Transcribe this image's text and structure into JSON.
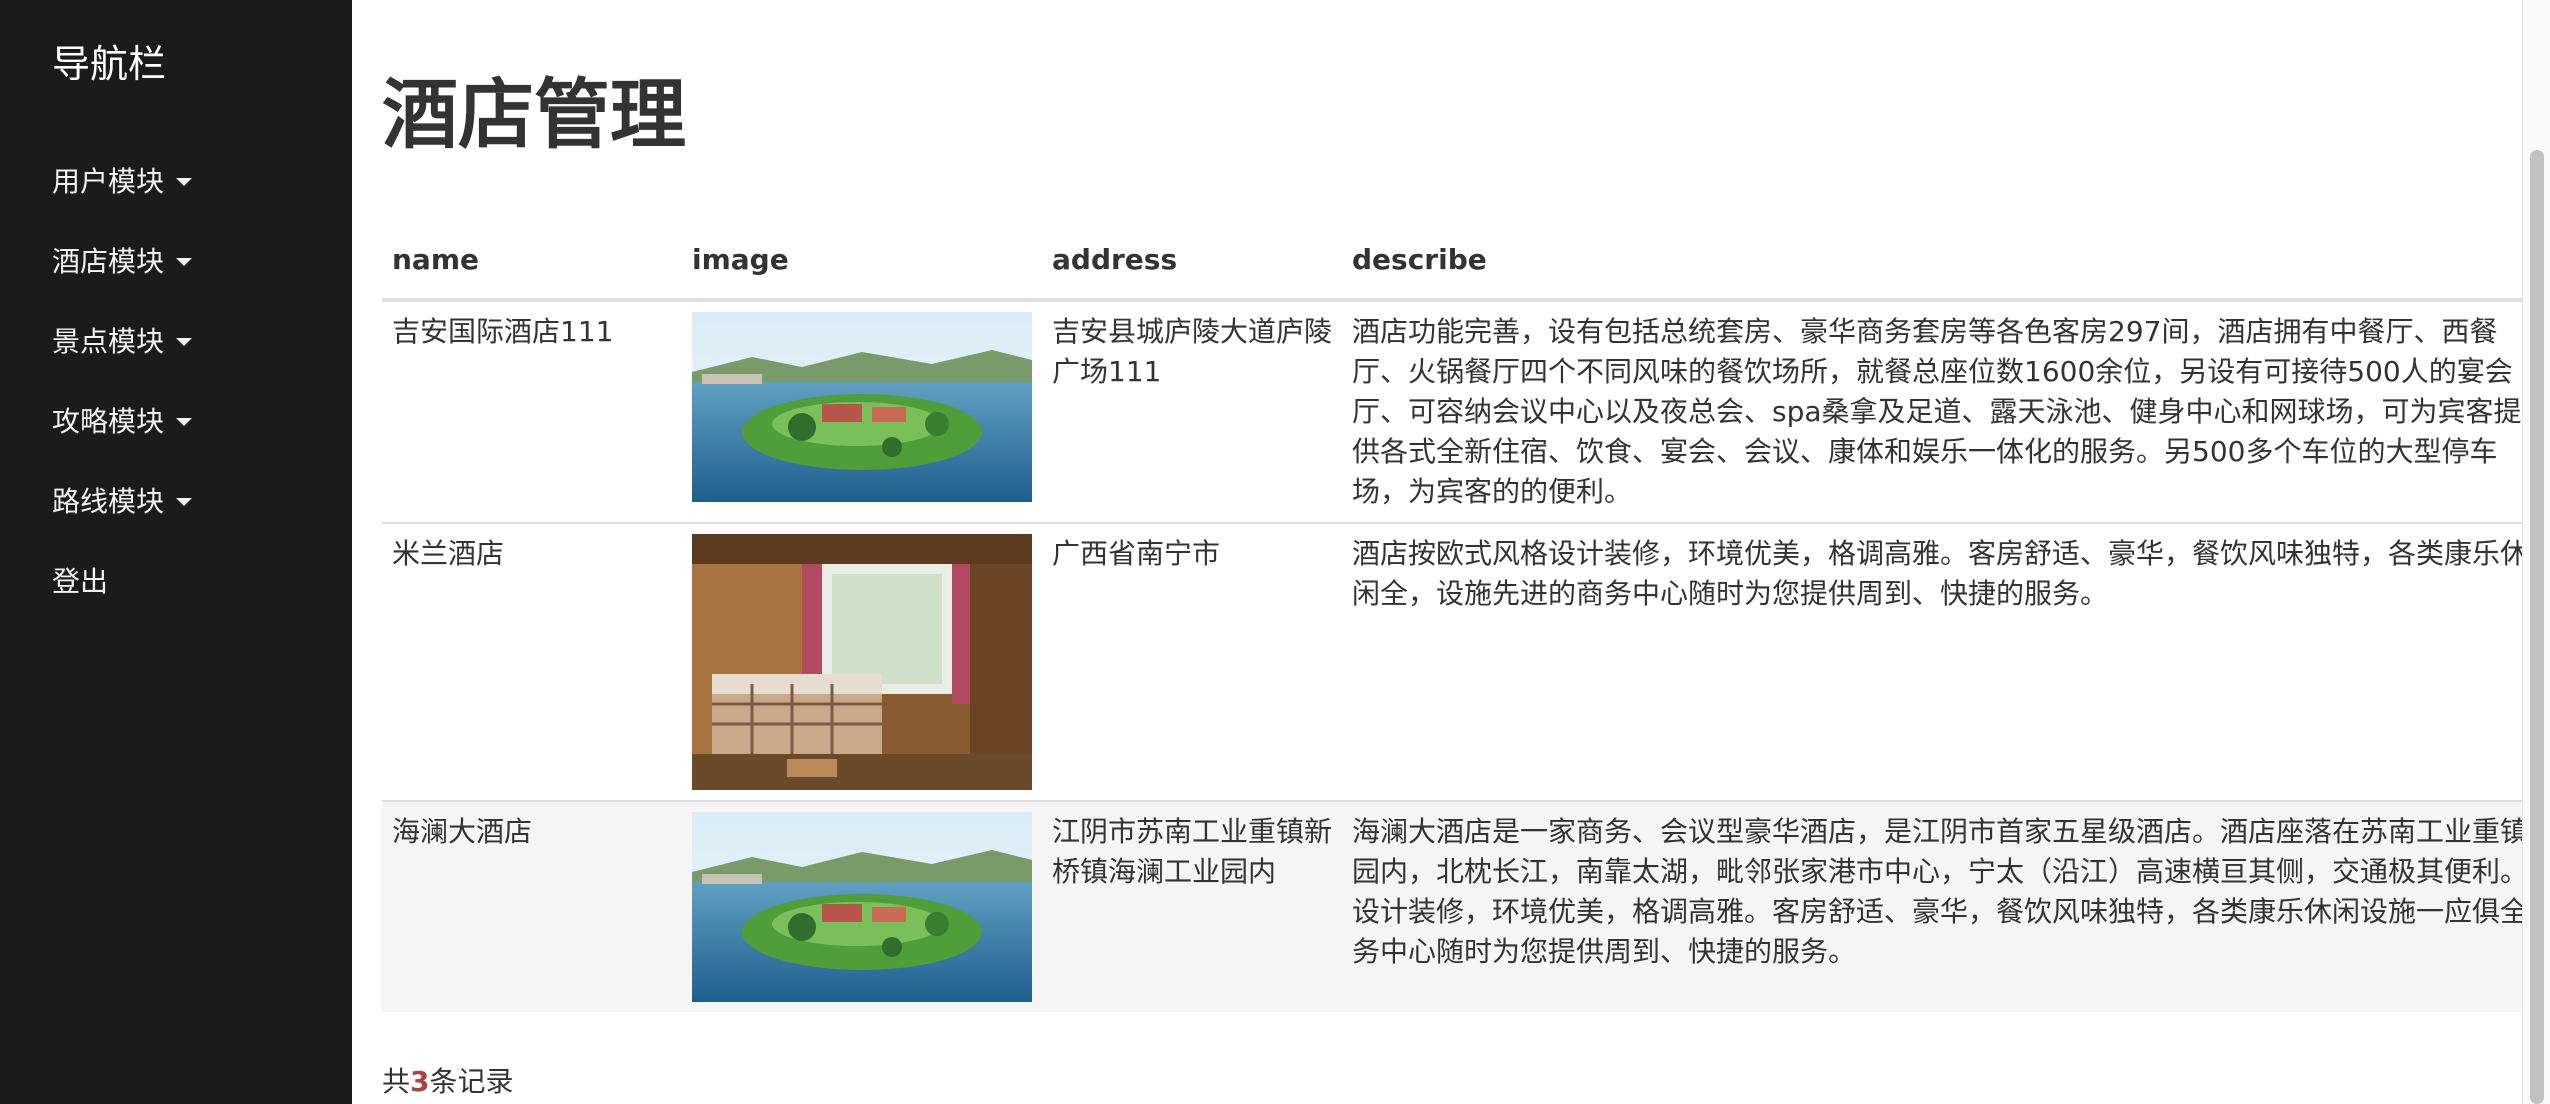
{
  "sidebar": {
    "title": "导航栏",
    "items": [
      {
        "label": "用户模块",
        "dropdown": true
      },
      {
        "label": "酒店模块",
        "dropdown": true
      },
      {
        "label": "景点模块",
        "dropdown": true
      },
      {
        "label": "攻略模块",
        "dropdown": true
      },
      {
        "label": "路线模块",
        "dropdown": true
      },
      {
        "label": "登出",
        "dropdown": false
      }
    ]
  },
  "page": {
    "title": "酒店管理"
  },
  "table": {
    "headers": [
      "name",
      "image",
      "address",
      "describe"
    ],
    "rows": [
      {
        "name": "吉安国际酒店111",
        "image": "lake-resort-photo",
        "address": "吉安县城庐陵大道庐陵广场111",
        "describe": "酒店功能完善，设有包括总统套房、豪华商务套房等各色客房297间，酒店拥有中餐厅、西餐厅、火锅餐厅四个不同风味的餐饮场所，就餐总座位数1600余位，另设有可接待500人的宴会厅、可容纳会议中心以及夜总会、spa桑拿及足道、露天泳池、健身中心和网球场，可为宾客提供各式全新住宿、饮食、宴会、会议、康体和娱乐一体化的服务。另500多个车位的大型停车场，为宾客的的便利。"
      },
      {
        "name": "米兰酒店",
        "image": "hotel-bedroom-photo",
        "address": "广西省南宁市",
        "describe": "酒店按欧式风格设计装修，环境优美，格调高雅。客房舒适、豪华，餐饮风味独特，各类康乐休闲全，设施先进的商务中心随时为您提供周到、快捷的服务。"
      },
      {
        "name": "海澜大酒店",
        "image": "lake-resort-photo",
        "address": "江阴市苏南工业重镇新桥镇海澜工业园内",
        "describe": "海澜大酒店是一家商务、会议型豪华酒店，是江阴市首家五星级酒店。酒店座落在苏南工业重镇园内，北枕长江，南靠太湖，毗邻张家港市中心，宁太（沿江）高速横亘其侧，交通极其便利。设计装修，环境优美，格调高雅。客房舒适、豪华，餐饮风味独特，各类康乐休闲设施一应俱全务中心随时为您提供周到、快捷的服务。"
      }
    ]
  },
  "footer": {
    "prefix": "共",
    "count": "3",
    "suffix": "条记录"
  },
  "colors": {
    "sidebar_bg": "#1b1b1b",
    "count_accent": "#a94442",
    "stripe": "#f5f5f5"
  }
}
